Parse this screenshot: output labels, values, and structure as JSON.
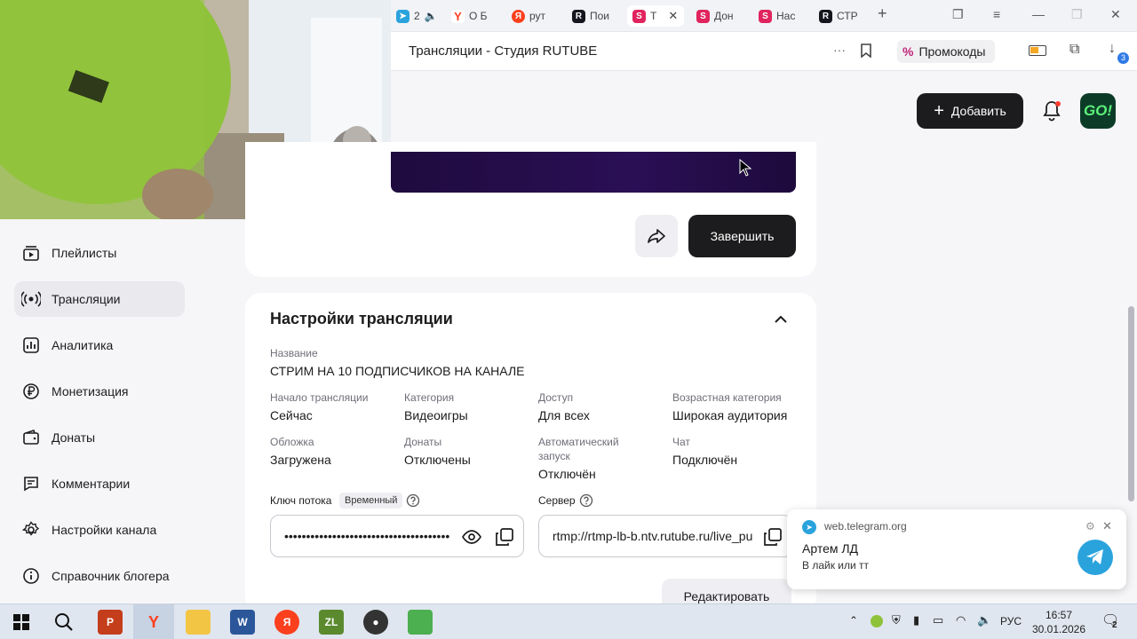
{
  "browser": {
    "tabs": [
      {
        "label": "2",
        "favicon": "telegram-icon"
      },
      {
        "label": "О Б",
        "favicon": "yandex-y-icon"
      },
      {
        "label": "рут",
        "favicon": "yandex-icon"
      },
      {
        "label": "Пои",
        "favicon": "rutube-icon"
      },
      {
        "label": "Т",
        "favicon": "studio-icon"
      },
      {
        "label": "Дон",
        "favicon": "studio-icon"
      },
      {
        "label": "Нас",
        "favicon": "studio-icon"
      },
      {
        "label": "СТР",
        "favicon": "rutube-icon"
      }
    ],
    "page_title": "Трансляции - Студия RUTUBE",
    "promo_label": "Промокоды",
    "downloads_badge": "3"
  },
  "header": {
    "add_label": "Добавить",
    "avatar_text": "GO!"
  },
  "sidebar": {
    "items": [
      {
        "label": "Плейлисты",
        "icon": "playlist-icon"
      },
      {
        "label": "Трансляции",
        "icon": "broadcast-icon"
      },
      {
        "label": "Аналитика",
        "icon": "analytics-icon"
      },
      {
        "label": "Монетизация",
        "icon": "ruble-icon"
      },
      {
        "label": "Донаты",
        "icon": "wallet-icon"
      },
      {
        "label": "Комментарии",
        "icon": "comment-icon"
      },
      {
        "label": "Настройки канала",
        "icon": "gear-icon"
      },
      {
        "label": "Справочник блогера",
        "icon": "info-icon"
      }
    ]
  },
  "stream": {
    "finish_label": "Завершить"
  },
  "settings": {
    "title": "Настройки трансляции",
    "name_label": "Название",
    "name_value": "СТРИМ НА 10 ПОДПИСЧИКОВ НА КАНАЛЕ",
    "start_label": "Начало трансляции",
    "start_value": "Сейчас",
    "category_label": "Категория",
    "category_value": "Видеоигры",
    "access_label": "Доступ",
    "access_value": "Для всех",
    "age_label": "Возрастная категория",
    "age_value": "Широкая аудитория",
    "cover_label": "Обложка",
    "cover_value": "Загружена",
    "donates_label": "Донаты",
    "donates_value": "Отключены",
    "autostart_label": "Автоматический запуск",
    "autostart_value": "Отключён",
    "chat_label": "Чат",
    "chat_value": "Подключён",
    "key_label": "Ключ потока",
    "key_tag": "Временный",
    "key_value": "••••••••••••••••••••••••••••••••••••••",
    "server_label": "Сервер",
    "server_value": "rtmp://rtmp-lb-b.ntv.rutube.ru/live_pu",
    "edit_label": "Редактировать"
  },
  "notification": {
    "source": "web.telegram.org",
    "title": "Артем ЛД",
    "message": "В лайк или тт"
  },
  "taskbar": {
    "lang": "РУС",
    "time": "16:57",
    "date": "30.01.2026",
    "notif_count": "2"
  }
}
